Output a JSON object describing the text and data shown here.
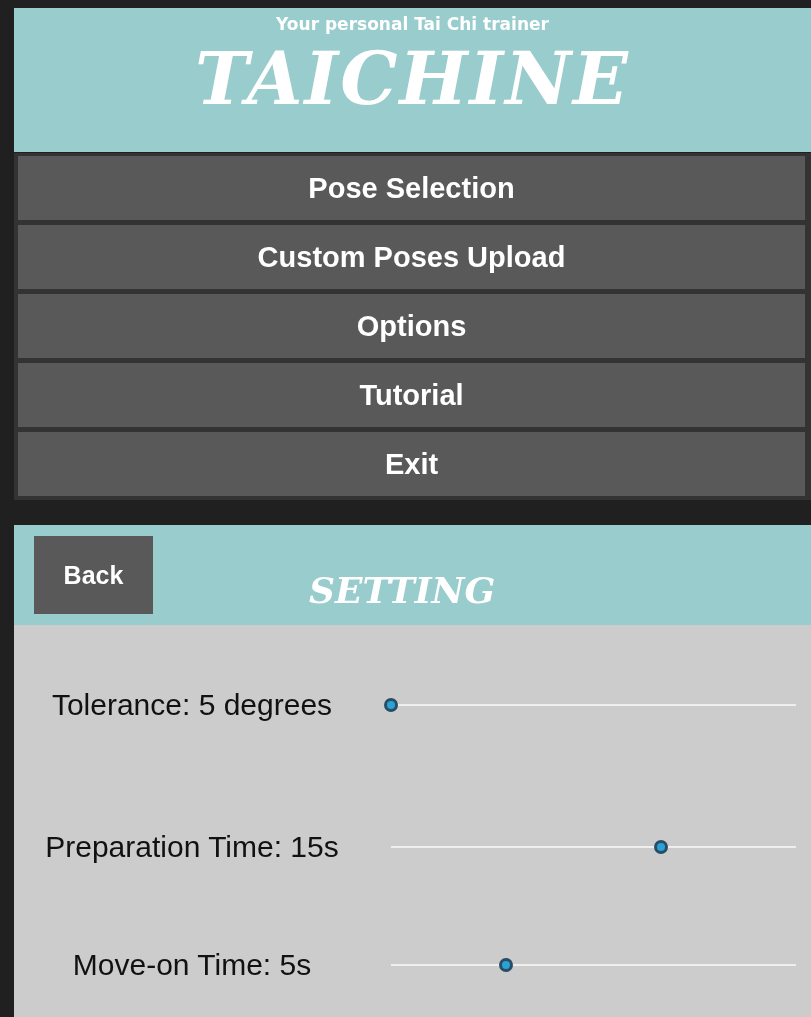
{
  "banner": {
    "tagline": "Your personal Tai Chi trainer",
    "title": "TAICHINE"
  },
  "menu": [
    {
      "label": "Pose Selection"
    },
    {
      "label": "Custom Poses Upload"
    },
    {
      "label": "Options"
    },
    {
      "label": "Tutorial"
    },
    {
      "label": "Exit"
    }
  ],
  "settings": {
    "back_button": "Back",
    "title": "SETTING",
    "sliders": [
      {
        "label": "Tolerance: 5 degrees",
        "level": 0
      },
      {
        "label": "Preparation Time: 15s",
        "level": 0.667
      },
      {
        "label": "Move-on Time: 5s",
        "level": 0.284
      }
    ]
  }
}
